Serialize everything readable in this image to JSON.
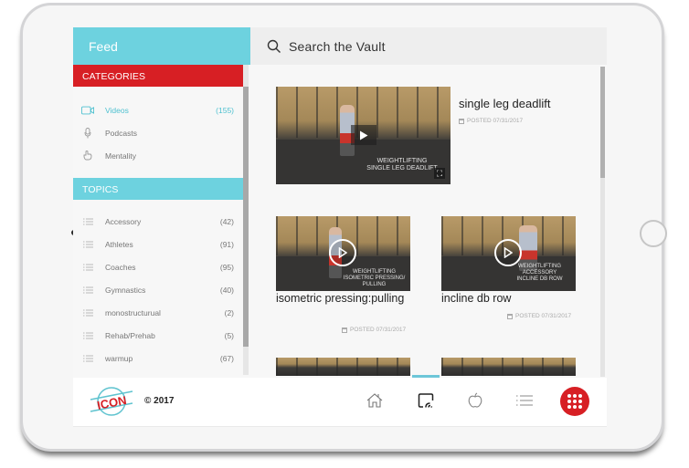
{
  "sidebar": {
    "title": "Feed",
    "categories_header": "CATEGORIES",
    "categories": [
      {
        "icon": "video-camera-icon",
        "label": "Videos",
        "count": "(155)",
        "active": true
      },
      {
        "icon": "microphone-icon",
        "label": "Podcasts",
        "count": "",
        "active": false
      },
      {
        "icon": "hand-icon",
        "label": "Mentality",
        "count": "",
        "active": false
      }
    ],
    "topics_header": "TOPICS",
    "topics": [
      {
        "label": "Accessory",
        "count": "(42)"
      },
      {
        "label": "Athletes",
        "count": "(91)"
      },
      {
        "label": "Coaches",
        "count": "(95)"
      },
      {
        "label": "Gymnastics",
        "count": "(40)"
      },
      {
        "label": "monostructurual",
        "count": "(2)"
      },
      {
        "label": "Rehab/Prehab",
        "count": "(5)"
      },
      {
        "label": "warmup",
        "count": "(67)"
      }
    ]
  },
  "search": {
    "placeholder": "Search the Vault"
  },
  "videos": [
    {
      "title": "single leg deadlift",
      "posted": "POSTED 07/31/2017",
      "overlay_lines": [
        "WEIGHTLIFTING",
        "SINGLE LEG DEADLIFT"
      ]
    },
    {
      "title": "isometric pressing:pulling",
      "posted": "POSTED 07/31/2017",
      "overlay_lines": [
        "WEIGHTLIFTING",
        "ISOMETRIC PRESSING/",
        "PULLING"
      ]
    },
    {
      "title": "incline db row",
      "posted": "POSTED 07/31/2017",
      "overlay_lines": [
        "WEIGHTLIFTING",
        "ACCESSORY",
        "INCLINE DB ROW"
      ]
    }
  ],
  "footer": {
    "logo_text": "ICON",
    "copyright": "© 2017",
    "nav": [
      {
        "name": "home",
        "icon": "home-icon"
      },
      {
        "name": "feed",
        "icon": "cast-icon",
        "active": true
      },
      {
        "name": "nutrition",
        "icon": "apple-icon"
      },
      {
        "name": "list",
        "icon": "list-icon"
      },
      {
        "name": "apps",
        "icon": "grid-icon"
      }
    ]
  },
  "colors": {
    "accent_teal": "#6dd2df",
    "accent_red": "#d71f24"
  }
}
